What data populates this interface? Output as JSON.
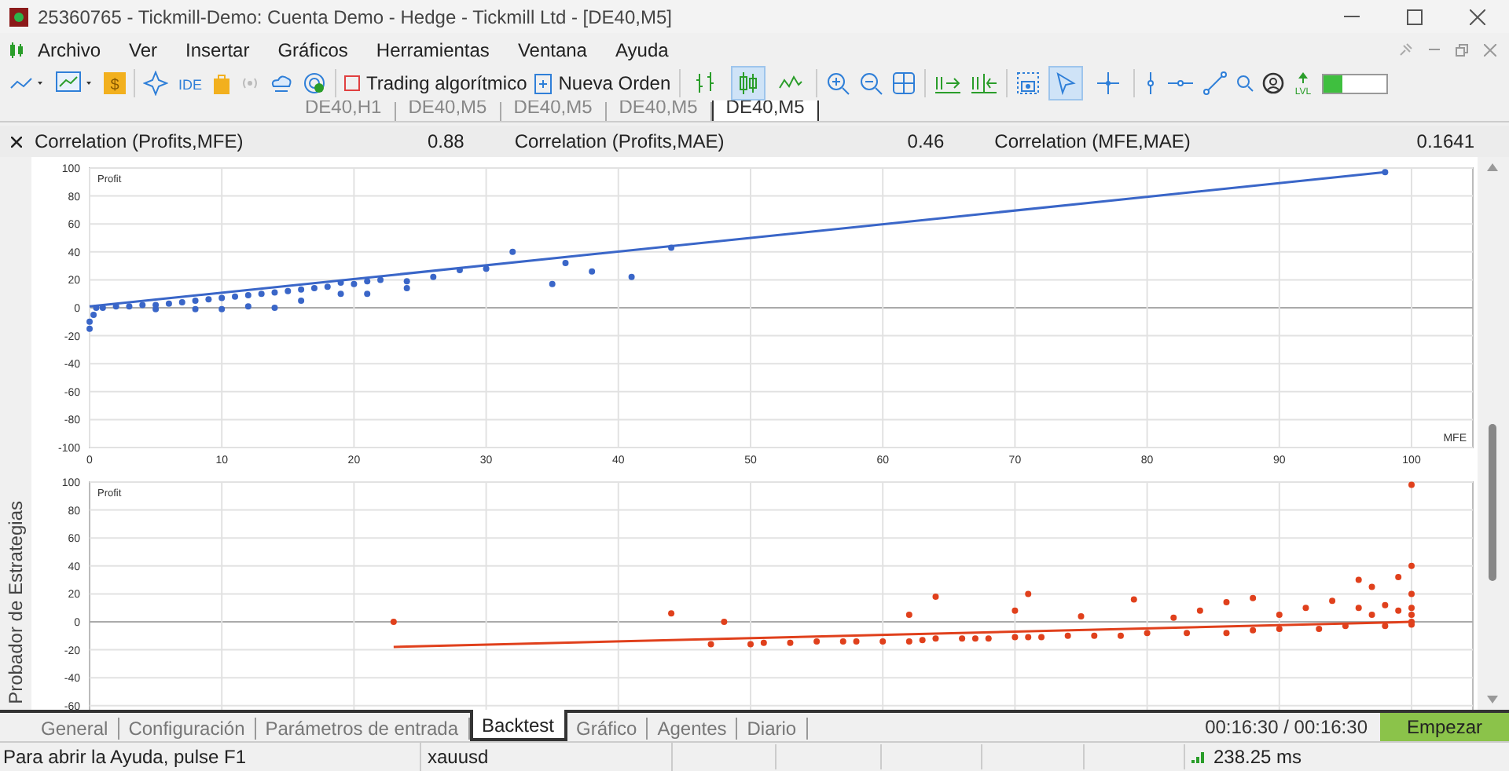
{
  "window": {
    "title": "25360765 - Tickmill-Demo: Cuenta Demo - Hedge - Tickmill Ltd - [DE40,M5]"
  },
  "menu": [
    "Archivo",
    "Ver",
    "Insertar",
    "Gráficos",
    "Herramientas",
    "Ventana",
    "Ayuda"
  ],
  "toolbar": {
    "icon_texts": [
      "$",
      "IDE",
      "LVL"
    ],
    "buttons": [
      "Trading algorítmico",
      "Nueva Orden"
    ],
    "chart_types": [
      {
        "selected": false
      },
      {
        "selected": true
      },
      {
        "selected": false
      }
    ],
    "cursor_tools": [
      {
        "selected": true
      },
      {
        "selected": false
      }
    ],
    "meter": {
      "level": 0.3
    }
  },
  "chart_tabs": [
    {
      "label": "DE40,H1",
      "selected": false
    },
    {
      "label": "DE40,M5",
      "selected": false
    },
    {
      "label": "DE40,M5",
      "selected": false
    },
    {
      "label": "DE40,M5",
      "selected": false
    },
    {
      "label": "DE40,M5",
      "selected": true
    }
  ],
  "correlations": [
    {
      "label": "Correlation (Profits,MFE)",
      "value": "0.88"
    },
    {
      "label": "Correlation (Profits,MAE)",
      "value": "0.46"
    },
    {
      "label": "Correlation (MFE,MAE)",
      "value": "0.1641"
    }
  ],
  "charts": [
    {
      "chart_data": {
        "type": "scatter",
        "grid": true,
        "ylabel": "Profit",
        "xlabel": "MFE",
        "xlim": [
          0,
          100
        ],
        "ylim": [
          -100,
          100
        ],
        "xticks": [
          0,
          10,
          20,
          30,
          40,
          50,
          60,
          70,
          80,
          90,
          100
        ],
        "yticks": [
          100,
          80,
          60,
          40,
          20,
          0,
          -20,
          -40,
          -60,
          -80,
          -100
        ],
        "x": [
          0,
          0,
          0.3,
          0.5,
          1,
          2,
          3,
          4,
          5,
          6,
          7,
          8,
          9,
          10,
          11,
          12,
          13,
          14,
          15,
          16,
          17,
          18,
          19,
          20,
          21,
          22,
          24,
          26,
          28,
          30,
          32,
          35,
          36,
          38,
          41,
          44,
          98,
          5,
          8,
          10,
          12,
          14,
          16,
          19,
          21,
          24
        ],
        "series": [
          {
            "type": "scatter",
            "color": "#3a66c8",
            "values": [
              -15,
              -10,
              -5,
              0,
              0,
              1,
              1,
              2,
              2,
              3,
              4,
              5,
              6,
              7,
              8,
              9,
              10,
              11,
              12,
              13,
              14,
              15,
              18,
              17,
              19,
              20,
              19,
              22,
              27,
              28,
              40,
              17,
              32,
              26,
              22,
              43,
              97,
              -1,
              -1,
              -1,
              1,
              0,
              5,
              10,
              10,
              14
            ]
          },
          {
            "type": "line",
            "color": "#3a66c8",
            "values": [
              1,
              null,
              null,
              null,
              null,
              null,
              null,
              null,
              null,
              null,
              null,
              null,
              null,
              null,
              null,
              null,
              null,
              null,
              null,
              null,
              null,
              null,
              null,
              null,
              null,
              null,
              null,
              null,
              null,
              null,
              null,
              null,
              null,
              null,
              null,
              null,
              97,
              null,
              null,
              null,
              null,
              null,
              null,
              null,
              null,
              null
            ]
          }
        ]
      }
    },
    {
      "chart_data": {
        "type": "scatter",
        "grid": true,
        "ylabel": "Profit",
        "xlim": [
          0,
          100
        ],
        "ylim": [
          -100,
          100
        ],
        "yticks": [
          100,
          80,
          60,
          40,
          20,
          0,
          -20,
          -40,
          -60
        ],
        "x": [
          23,
          47,
          50,
          51,
          53,
          55,
          57,
          58,
          60,
          62,
          63,
          64,
          66,
          67,
          68,
          70,
          71,
          72,
          74,
          76,
          78,
          80,
          83,
          86,
          88,
          90,
          93,
          95,
          98,
          100,
          100,
          100,
          100,
          100,
          100,
          100,
          44,
          48,
          62,
          64,
          71,
          70,
          75,
          79,
          86,
          88,
          94,
          96,
          97,
          99,
          92,
          90,
          84,
          82,
          96,
          98,
          97,
          99
        ],
        "series": [
          {
            "type": "scatter",
            "color": "#e0401c",
            "values": [
              0,
              -16,
              -16,
              -15,
              -15,
              -14,
              -14,
              -14,
              -14,
              -14,
              -13,
              -12,
              -12,
              -12,
              -12,
              -11,
              -11,
              -11,
              -10,
              -10,
              -10,
              -8,
              -8,
              -8,
              -6,
              -5,
              -5,
              -3,
              -3,
              -2,
              0,
              5,
              10,
              20,
              40,
              98,
              6,
              0,
              5,
              18,
              20,
              8,
              4,
              16,
              14,
              17,
              15,
              30,
              25,
              32,
              10,
              5,
              8,
              3,
              10,
              12,
              5,
              8
            ]
          },
          {
            "type": "line",
            "color": "#e0401c",
            "values": [
              -18,
              null,
              null,
              null,
              null,
              null,
              null,
              null,
              null,
              null,
              null,
              null,
              null,
              null,
              null,
              null,
              null,
              null,
              null,
              null,
              null,
              null,
              null,
              null,
              null,
              null,
              null,
              null,
              null,
              0,
              null,
              null,
              null,
              null,
              null,
              null,
              null,
              null,
              null,
              null,
              null,
              null,
              null,
              null,
              null,
              null,
              null,
              null,
              null,
              null,
              null,
              null,
              null,
              null,
              null,
              null,
              null,
              null
            ]
          }
        ]
      }
    }
  ],
  "side_tab": "Probador de Estrategias",
  "tester_tabs": [
    {
      "label": "General",
      "selected": false
    },
    {
      "label": "Configuración",
      "selected": false
    },
    {
      "label": "Parámetros de entrada",
      "selected": false
    },
    {
      "label": "Backtest",
      "selected": true
    },
    {
      "label": "Gráfico",
      "selected": false
    },
    {
      "label": "Agentes",
      "selected": false
    },
    {
      "label": "Diario",
      "selected": false
    }
  ],
  "elapsed": "00:16:30 / 00:16:30",
  "start_button": "Empezar",
  "status_bar": {
    "help": "Para abrir la Ayuda, pulse F1",
    "symbol": "xauusd",
    "ping": "238.25 ms"
  }
}
